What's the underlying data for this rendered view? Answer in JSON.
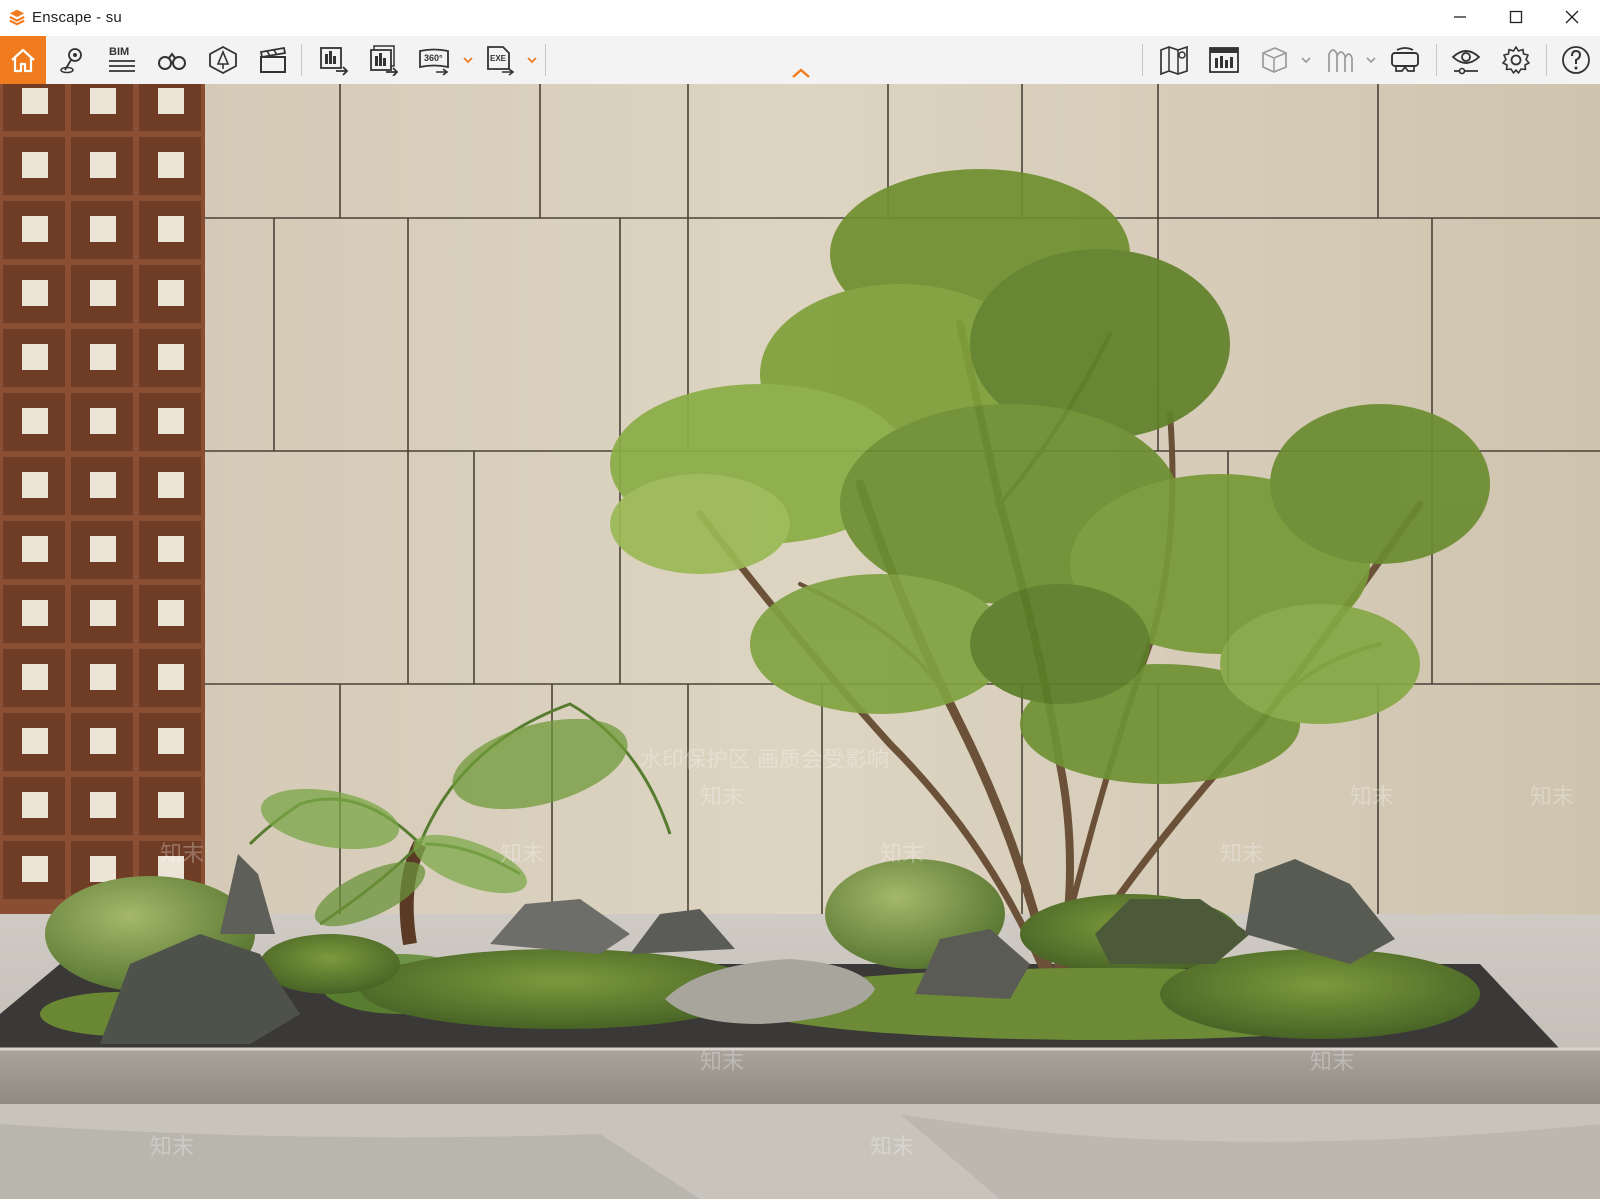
{
  "window": {
    "title": "Enscape - su",
    "controls": [
      "minimize",
      "maximize",
      "close"
    ]
  },
  "toolbar": {
    "left_tools": [
      {
        "name": "home",
        "icon": "home-icon",
        "active": true
      },
      {
        "name": "views",
        "icon": "map-pin-icon"
      },
      {
        "name": "bim",
        "icon": "bim-icon",
        "label": "BIM"
      },
      {
        "name": "explorer",
        "icon": "binoculars-icon"
      },
      {
        "name": "asset-library",
        "icon": "asset-library-icon"
      },
      {
        "name": "video-editor",
        "icon": "clapperboard-icon"
      },
      {
        "name": "render-image",
        "icon": "render-image-icon"
      },
      {
        "name": "batch-render",
        "icon": "batch-render-icon"
      },
      {
        "name": "panorama",
        "icon": "panorama-360-icon",
        "label": "360°"
      },
      {
        "name": "export-exe",
        "icon": "exe-export-icon",
        "label": "EXE"
      }
    ],
    "right_tools": [
      {
        "name": "map",
        "icon": "map-icon"
      },
      {
        "name": "bim-info",
        "icon": "bim-info-icon"
      },
      {
        "name": "section",
        "icon": "cube-icon"
      },
      {
        "name": "material-editor",
        "icon": "material-icon"
      },
      {
        "name": "vr-headset",
        "icon": "vr-headset-icon"
      },
      {
        "name": "visual-settings",
        "icon": "eye-settings-icon"
      },
      {
        "name": "settings",
        "icon": "gear-icon"
      },
      {
        "name": "help",
        "icon": "help-icon"
      }
    ],
    "accent_color": "#f07c1f"
  },
  "viewport": {
    "watermark": {
      "primary": "知末",
      "secondary": "水印保护区  画质会受影响"
    }
  }
}
